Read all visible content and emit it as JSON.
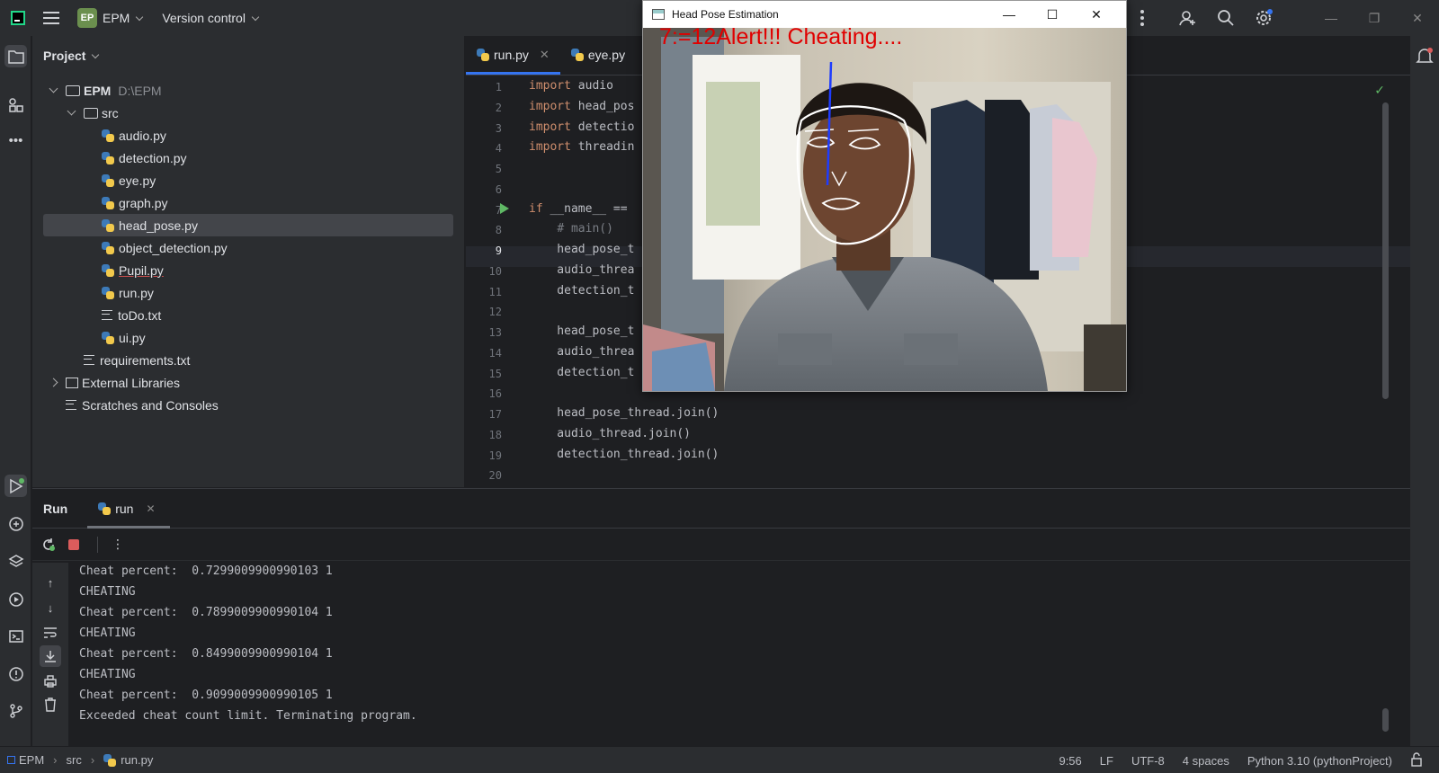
{
  "topbar": {
    "project_badge": "EP",
    "project_name": "EPM",
    "vcs_label": "Version control"
  },
  "project_panel": {
    "title": "Project",
    "tree": [
      {
        "label": "EPM",
        "detail": "D:\\EPM",
        "type": "folder",
        "level": 0,
        "expanded": true
      },
      {
        "label": "src",
        "type": "folder",
        "level": 1,
        "expanded": true
      },
      {
        "label": "audio.py",
        "type": "python",
        "level": 2
      },
      {
        "label": "detection.py",
        "type": "python",
        "level": 2
      },
      {
        "label": "eye.py",
        "type": "python",
        "level": 2
      },
      {
        "label": "graph.py",
        "type": "python",
        "level": 2
      },
      {
        "label": "head_pose.py",
        "type": "python",
        "level": 2,
        "selected": true
      },
      {
        "label": "object_detection.py",
        "type": "python",
        "level": 2
      },
      {
        "label": "Pupil.py",
        "type": "python",
        "level": 2,
        "error": true
      },
      {
        "label": "run.py",
        "type": "python",
        "level": 2
      },
      {
        "label": "toDo.txt",
        "type": "text",
        "level": 2
      },
      {
        "label": "ui.py",
        "type": "python",
        "level": 2
      },
      {
        "label": "requirements.txt",
        "type": "text",
        "level": 1
      },
      {
        "label": "External Libraries",
        "type": "library",
        "level": 0,
        "expanded": false
      },
      {
        "label": "Scratches and Consoles",
        "type": "scratches",
        "level": 0
      }
    ]
  },
  "editor": {
    "tabs": [
      {
        "label": "run.py",
        "active": true,
        "closable": true
      },
      {
        "label": "eye.py",
        "active": false
      }
    ],
    "current_line": 9,
    "lines": [
      {
        "n": "1",
        "code": "import audio"
      },
      {
        "n": "2",
        "code": "import head_pos"
      },
      {
        "n": "3",
        "code": "import detectio"
      },
      {
        "n": "4",
        "code": "import threadin"
      },
      {
        "n": "5",
        "code": ""
      },
      {
        "n": "6",
        "code": ""
      },
      {
        "n": "7",
        "code": "if __name__ =="
      },
      {
        "n": "8",
        "code": "    # main()"
      },
      {
        "n": "9",
        "code": "    head_pose_t"
      },
      {
        "n": "10",
        "code": "    audio_threa"
      },
      {
        "n": "11",
        "code": "    detection_t"
      },
      {
        "n": "12",
        "code": ""
      },
      {
        "n": "13",
        "code": "    head_pose_t"
      },
      {
        "n": "14",
        "code": "    audio_threa"
      },
      {
        "n": "15",
        "code": "    detection_t"
      },
      {
        "n": "16",
        "code": ""
      },
      {
        "n": "17",
        "code": "    head_pose_thread.join()"
      },
      {
        "n": "18",
        "code": "    audio_thread.join()"
      },
      {
        "n": "19",
        "code": "    detection_thread.join()"
      },
      {
        "n": "20",
        "code": ""
      }
    ]
  },
  "run_panel": {
    "title": "Run",
    "tab_label": "run",
    "output": [
      "Cheat percent:  0.7299009900990103 1",
      "CHEATING",
      "Cheat percent:  0.7899009900990104 1",
      "CHEATING",
      "Cheat percent:  0.8499009900990104 1",
      "CHEATING",
      "Cheat percent:  0.9099009900990105 1",
      "Exceeded cheat count limit. Terminating program."
    ]
  },
  "statusbar": {
    "breadcrumb": [
      "EPM",
      "src",
      "run.py"
    ],
    "caret": "9:56",
    "line_sep": "LF",
    "encoding": "UTF-8",
    "indent": "4 spaces",
    "interpreter": "Python 3.10 (pythonProject)"
  },
  "cv_window": {
    "title": "Head Pose Estimation",
    "overlay_text": "7:=12Alert!!! Cheating...."
  }
}
